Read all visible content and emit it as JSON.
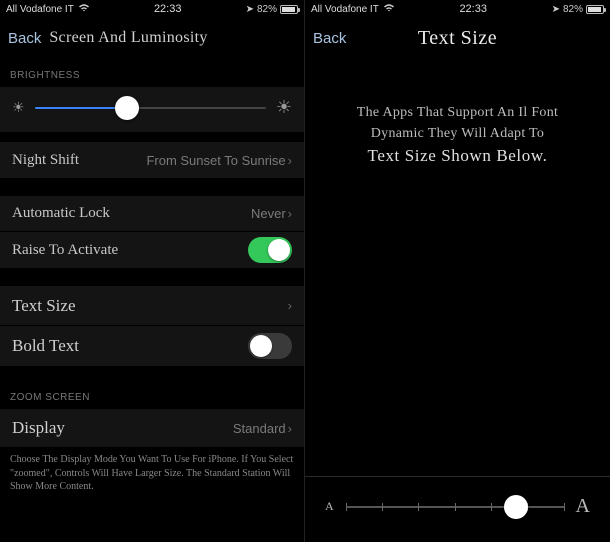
{
  "status": {
    "carrier": "All Vodafone IT",
    "time": "22:33",
    "battery_pct": "82%"
  },
  "left": {
    "back": "Back",
    "title": "Screen And Luminosity",
    "brightness_header": "BRIGHTNESS",
    "brightness_value_pct": 40,
    "night_shift": {
      "label": "Night Shift",
      "value": "From Sunset To Sunrise"
    },
    "auto_lock": {
      "label": "Automatic Lock",
      "value": "Never"
    },
    "raise": {
      "label": "Raise To Activate",
      "on": true
    },
    "text_size": {
      "label": "Text Size"
    },
    "bold_text": {
      "label": "Bold Text",
      "on": false
    },
    "zoom_header": "ZOOM SCREEN",
    "display": {
      "label": "Display",
      "value": "Standard"
    },
    "footer": "Choose The Display Mode You Want To Use For iPhone. If You Select \"zoomed\", Controls Will Have Larger Size. The Standard Station Will Show More Content."
  },
  "right": {
    "back": "Back",
    "title": "Text Size",
    "desc_l1": "The Apps That Support An Il Font",
    "desc_l2": "Dynamic They Will Adapt To",
    "desc_bold": "Text Size Shown Below.",
    "slider_value_pct": 78,
    "small_a": "A",
    "large_a": "A"
  }
}
